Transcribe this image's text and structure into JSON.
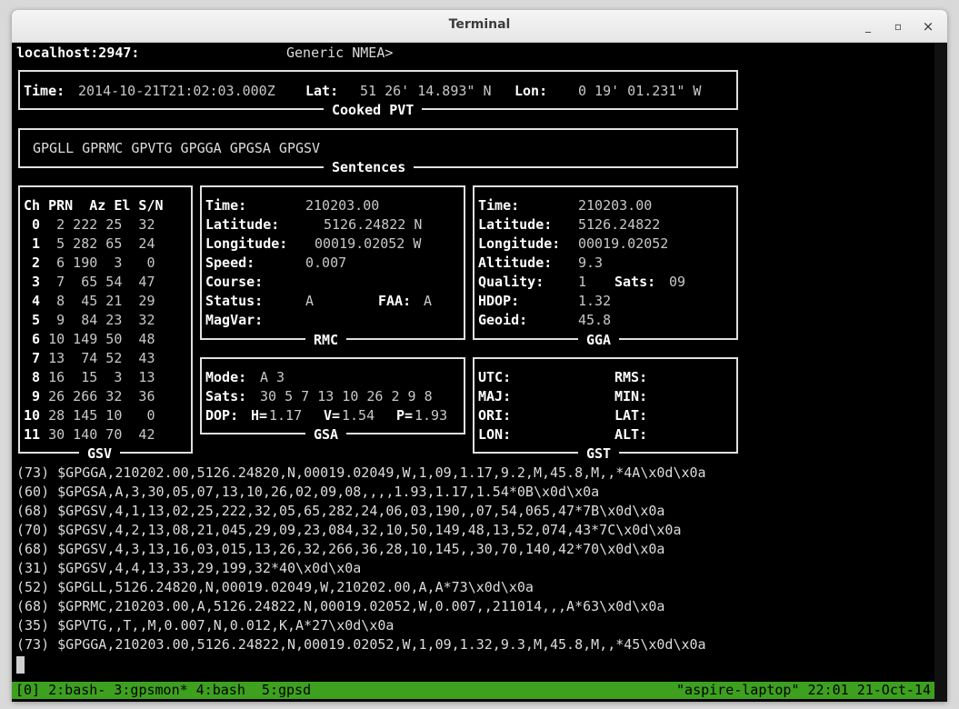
{
  "window": {
    "title": "Terminal",
    "min": "_",
    "max": "▫",
    "close": "×"
  },
  "header": {
    "host": "localhost:2947:",
    "device": "Generic NMEA>"
  },
  "pvt": {
    "time_label": "Time:",
    "time": "2014-10-21T21:02:03.000Z",
    "lat_label": "Lat:",
    "lat": "51 26' 14.893\" N",
    "lon_label": "Lon:",
    "lon": "0 19' 01.231\" W",
    "title": "Cooked PVT"
  },
  "sentences": {
    "list": "GPGLL GPRMC GPVTG GPGGA GPGSA GPGSV",
    "title": "Sentences"
  },
  "gsv": {
    "header": "Ch PRN  Az El S/N",
    "title": "GSV",
    "rows": [
      {
        "ch": " 0",
        "data": "  2 222 25  32"
      },
      {
        "ch": " 1",
        "data": "  5 282 65  24"
      },
      {
        "ch": " 2",
        "data": "  6 190  3   0"
      },
      {
        "ch": " 3",
        "data": "  7  65 54  47"
      },
      {
        "ch": " 4",
        "data": "  8  45 21  29"
      },
      {
        "ch": " 5",
        "data": "  9  84 23  32"
      },
      {
        "ch": " 6",
        "data": " 10 149 50  48"
      },
      {
        "ch": " 7",
        "data": " 13  74 52  43"
      },
      {
        "ch": " 8",
        "data": " 16  15  3  13"
      },
      {
        "ch": " 9",
        "data": " 26 266 32  36"
      },
      {
        "ch": "10",
        "data": " 28 145 10   0"
      },
      {
        "ch": "11",
        "data": " 30 140 70  42"
      }
    ]
  },
  "rmc": {
    "title": "RMC",
    "time_label": "Time:",
    "time": "210203.00",
    "lat_label": "Latitude:",
    "lat": "5126.24822 N",
    "lon_label": "Longitude:",
    "lon": "00019.02052 W",
    "speed_label": "Speed:",
    "speed": "0.007",
    "course_label": "Course:",
    "status_label": "Status:",
    "status": "A",
    "faa_label": "FAA:",
    "faa": "A",
    "magvar_label": "MagVar:"
  },
  "gga": {
    "title": "GGA",
    "time_label": "Time:",
    "time": "210203.00",
    "lat_label": "Latitude:",
    "lat": "5126.24822",
    "lon_label": "Longitude:",
    "lon": "00019.02052",
    "alt_label": "Altitude:",
    "alt": "9.3",
    "quality_label": "Quality:",
    "quality": "1",
    "sats_label": "Sats:",
    "sats": "09",
    "hdop_label": "HDOP:",
    "hdop": "1.32",
    "geoid_label": "Geoid:",
    "geoid": "45.8"
  },
  "gsa": {
    "title": "GSA",
    "mode_label": "Mode:",
    "mode": "A 3",
    "sats_label": "Sats:",
    "sats": "30 5 7 13 10 26 2 9 8",
    "dop_label": "DOP:",
    "h_label": "H=",
    "h": "1.17",
    "v_label": "V=",
    "v": "1.54",
    "p_label": "P=",
    "p": "1.93"
  },
  "gst": {
    "title": "GST",
    "utc_label": "UTC:",
    "rms_label": "RMS:",
    "maj_label": "MAJ:",
    "min_label": "MIN:",
    "ori_label": "ORI:",
    "lat_label": "LAT:",
    "lon_label": "LON:",
    "alt_label": "ALT:"
  },
  "nmea_log": [
    "(73) $GPGGA,210202.00,5126.24820,N,00019.02049,W,1,09,1.17,9.2,M,45.8,M,,*4A\\x0d\\x0a",
    "(60) $GPGSA,A,3,30,05,07,13,10,26,02,09,08,,,,1.93,1.17,1.54*0B\\x0d\\x0a",
    "(68) $GPGSV,4,1,13,02,25,222,32,05,65,282,24,06,03,190,,07,54,065,47*7B\\x0d\\x0a",
    "(70) $GPGSV,4,2,13,08,21,045,29,09,23,084,32,10,50,149,48,13,52,074,43*7C\\x0d\\x0a",
    "(68) $GPGSV,4,3,13,16,03,015,13,26,32,266,36,28,10,145,,30,70,140,42*70\\x0d\\x0a",
    "(31) $GPGSV,4,4,13,33,29,199,32*40\\x0d\\x0a",
    "(52) $GPGLL,5126.24820,N,00019.02049,W,210202.00,A,A*73\\x0d\\x0a",
    "(68) $GPRMC,210203.00,A,5126.24822,N,00019.02052,W,0.007,,211014,,,A*63\\x0d\\x0a",
    "(35) $GPVTG,,T,,M,0.007,N,0.012,K,A*27\\x0d\\x0a",
    "(73) $GPGGA,210203.00,5126.24822,N,00019.02052,W,1,09,1.32,9.3,M,45.8,M,,*45\\x0d\\x0a"
  ],
  "status_bar": {
    "windows": "[0] 2:bash- 3:gpsmon* 4:bash  5:gpsd",
    "right": "\"aspire-laptop\" 22:01 21-Oct-14"
  }
}
